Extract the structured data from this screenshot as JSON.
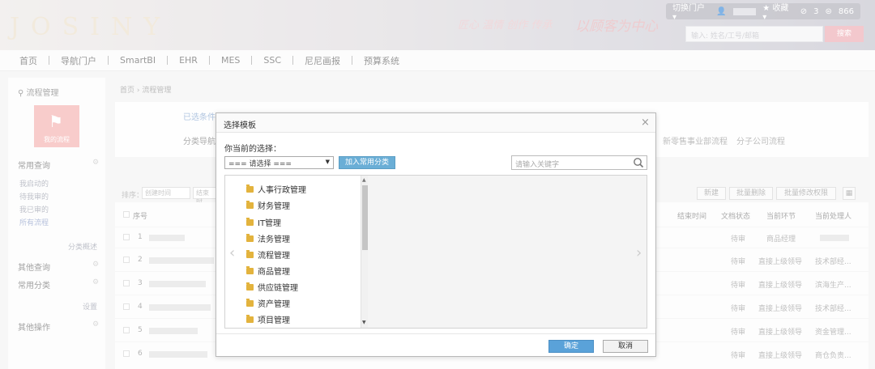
{
  "header": {
    "logo": "JOSINY",
    "slogan_left": "匠心 温情 创作 传承",
    "slogan_right": "以顾客为中心",
    "topbar": {
      "switch_portal": "切换门户 ▾",
      "favorites": "★ 收藏 ▾",
      "messages": "3",
      "tasks": "866"
    },
    "search_placeholder": "输入: 姓名/工号/邮箱",
    "search_button": "搜索"
  },
  "nav": [
    "首页",
    "导航门户",
    "SmartBI",
    "EHR",
    "MES",
    "SSC",
    "尼尼画报",
    "预算系统"
  ],
  "sidebar": {
    "title": "流程管理",
    "tile_label": "我的流程",
    "common_query": "常用查询",
    "links": [
      "我启动的",
      "待我审的",
      "我已审的",
      "所有流程"
    ],
    "category_browse": "分类概述",
    "other_query": "其他查询",
    "common_category": "常用分类",
    "settings": "设置",
    "other_ops": "其他操作"
  },
  "breadcrumb": "首页 › 流程管理",
  "filters": {
    "selected": "已选条件",
    "category_nav": "分类导航",
    "right1": "新零售事业部流程",
    "right2": "分子公司流程"
  },
  "toolbar": {
    "sort_label": "排序：",
    "sort_select": "创建时间",
    "sort_select2": "结束时",
    "new_btn": "新建",
    "batch_delete": "批量删除",
    "batch_perm": "批量修改权限"
  },
  "table": {
    "headers": {
      "no": "序号",
      "end_time": "结束时间",
      "doc_status": "文档状态",
      "current_step": "当前环节",
      "handler": "当前处理人"
    },
    "rows": [
      {
        "no": "1",
        "status": "待审",
        "step": "商品经理",
        "handler": ""
      },
      {
        "no": "2",
        "status": "待审",
        "step": "直接上级领导",
        "handler": "技术部经..."
      },
      {
        "no": "3",
        "status": "待审",
        "step": "直接上级领导",
        "handler": "滨海生产..."
      },
      {
        "no": "4",
        "status": "待审",
        "step": "直接上级领导",
        "handler": "技术部经..."
      },
      {
        "no": "5",
        "status": "待审",
        "step": "直接上级领导",
        "handler": "资金管理..."
      },
      {
        "no": "6",
        "status": "待审",
        "step": "直接上级领导",
        "handler": "商仓负责..."
      }
    ]
  },
  "modal": {
    "title": "选择模板",
    "current_label": "你当前的选择：",
    "select_placeholder": "=== 请选择 ===",
    "add_button": "加入常用分类",
    "search_placeholder": "请输入关键字",
    "tree_items": [
      "人事行政管理",
      "财务管理",
      "IT管理",
      "法务管理",
      "流程管理",
      "商品管理",
      "供应链管理",
      "资产管理",
      "项目管理"
    ],
    "ok": "确定",
    "cancel": "取消"
  },
  "colors": {
    "accent": "#5aa2d9",
    "folder": "#e3b33d",
    "tile": "#f2a3a0"
  }
}
